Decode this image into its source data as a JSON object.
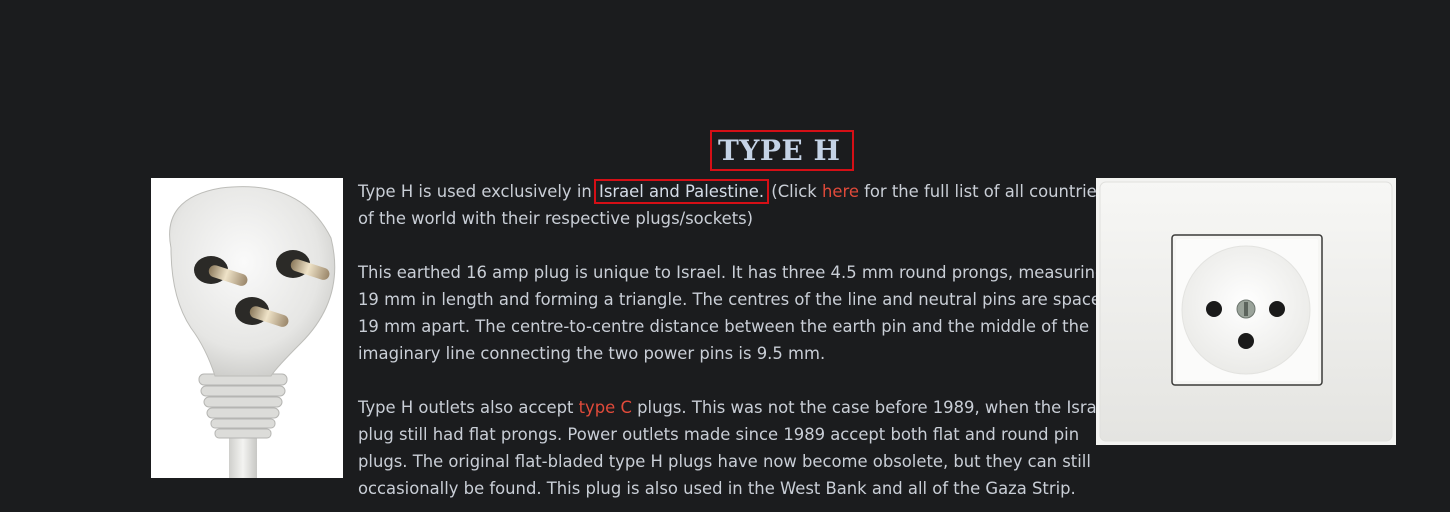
{
  "heading": "TYPE H",
  "paragraph1": {
    "pre": "Type H is used exclusively in",
    "highlight": "Israel and Palestine.",
    "mid": "(Click",
    "link": "here",
    "post_line1": "for the full list of all countries",
    "post_line2": "of the world with their respective plugs/sockets)"
  },
  "paragraph2": {
    "lines": [
      "This earthed 16 amp plug is unique to Israel. It has three 4.5 mm round prongs, measuring",
      "19 mm in length and forming a triangle. The centres of the line and neutral pins are spaced",
      "19 mm apart. The centre-to-centre distance between the earth pin and the middle of the",
      "imaginary line connecting the two power pins is 9.5 mm."
    ]
  },
  "paragraph3": {
    "pre": "Type H outlets also accept",
    "link": "type C",
    "post_line1": "plugs. This was not the case before 1989, when the Israeli",
    "lines": [
      "plug still had flat prongs. Power outlets made since 1989 accept both flat and round pin",
      "plugs. The original flat-bladed type H plugs have now become obsolete, but they can still",
      "occasionally be found. This plug is also used in the West Bank and all of the Gaza Strip."
    ]
  },
  "colors": {
    "background": "#1b1c1e",
    "text": "#c9ced6",
    "heading": "#c5d3e6",
    "link": "#e04a3a",
    "highlight_box": "#d50f16"
  }
}
